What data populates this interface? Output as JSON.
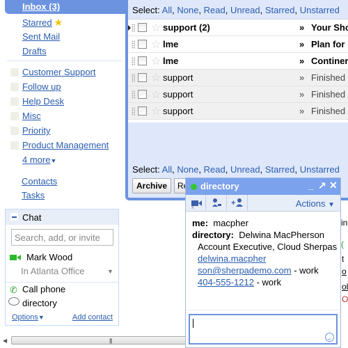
{
  "nav": {
    "inbox": "Inbox (3)",
    "starred": "Starred",
    "sent": "Sent Mail",
    "drafts": "Drafts",
    "labels": [
      "Customer Support",
      "Follow up",
      "Help Desk",
      "Misc",
      "Priority",
      "Product Management"
    ],
    "more": "4 more",
    "contacts": "Contacts",
    "tasks": "Tasks"
  },
  "chat": {
    "title": "Chat",
    "search_placeholder": "Search, add, or invite",
    "contact_name": "Mark Wood",
    "contact_status": "In Atlanta Office",
    "call_phone": "Call phone",
    "directory": "directory",
    "options": "Options",
    "add_contact": "Add contact"
  },
  "mail": {
    "select_label": "Select:",
    "select_options": [
      "All",
      "None",
      "Read",
      "Unread",
      "Starred",
      "Unstarred"
    ],
    "messages": [
      {
        "sender": "support (2)",
        "subject": "Your Sho",
        "unread": true
      },
      {
        "sender": "lme",
        "subject": "Plan for",
        "unread": true
      },
      {
        "sender": "lme",
        "subject": "Continer",
        "unread": true
      },
      {
        "sender": "support",
        "subject": "Finished",
        "unread": false
      },
      {
        "sender": "support",
        "subject": "Finished",
        "unread": false
      },
      {
        "sender": "support",
        "subject": "Finished",
        "unread": false
      }
    ],
    "raquo": "»",
    "archive": "Archive",
    "report": "Re"
  },
  "popup": {
    "title": "directory",
    "actions": "Actions",
    "me_label": "me:",
    "me_text": "macpher",
    "dir_label": "directory:",
    "dir_name": "Delwina MacPherson",
    "dir_title": "Account Executive, Cloud Sherpas",
    "email_part1": "delwina.macpher",
    "email_part2": "son@sherpademo.com",
    "email_suffix": " - work",
    "phone": "404-555-1212",
    "phone_suffix": " - work"
  },
  "background_fragments": [
    "in",
    "t",
    "o",
    "ol",
    "O"
  ]
}
